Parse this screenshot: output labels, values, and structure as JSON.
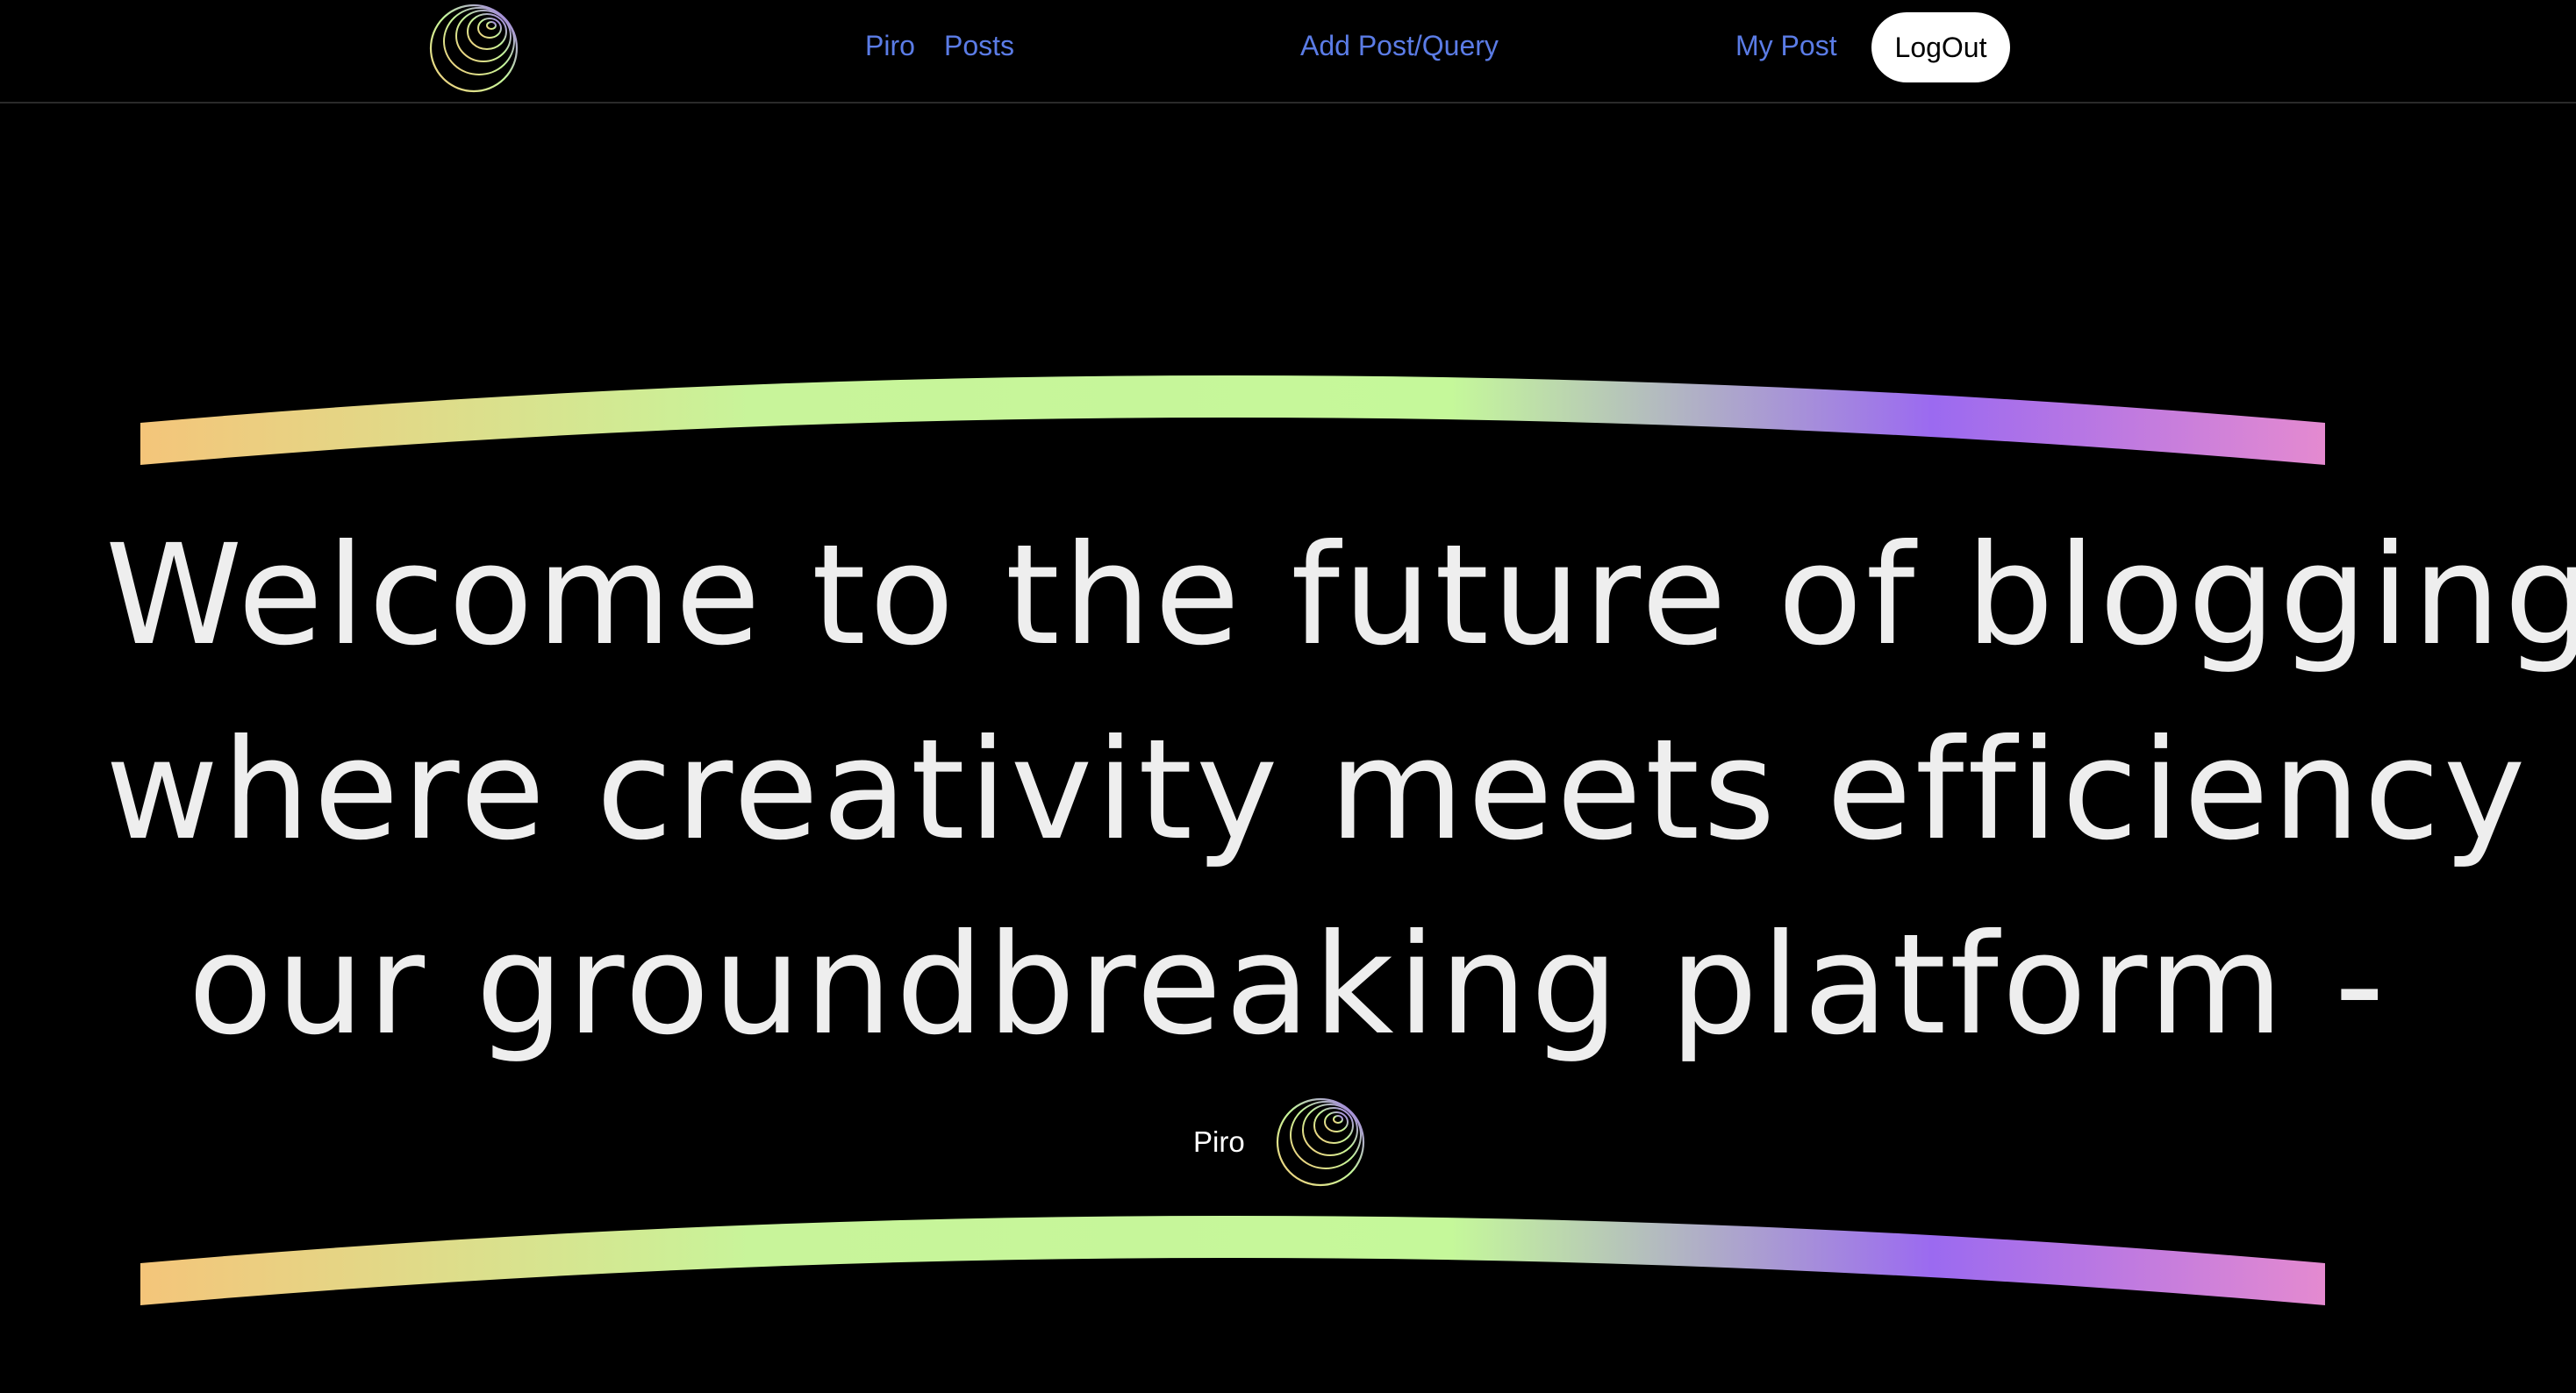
{
  "nav": {
    "brand_label": "Piro",
    "posts_label": "Posts",
    "add_label": "Add Post/Query",
    "my_post_label": "My Post",
    "logout_label": "LogOut",
    "logo_icon": "sphere-logo-icon",
    "link_color": "#5b7ce6"
  },
  "hero": {
    "lines": [
      "Welcome to the future of blogging,",
      "where creativity meets efficiency in",
      "our groundbreaking platform -"
    ],
    "author_name": "Piro",
    "author_icon": "sphere-logo-icon",
    "arc_gradient": [
      "#f6c97a",
      "#c5f89a",
      "#9b6af0",
      "#e38ad0"
    ]
  }
}
